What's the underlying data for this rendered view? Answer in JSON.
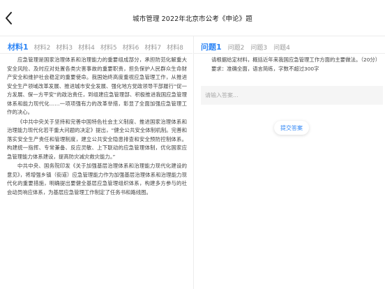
{
  "header": {
    "title": "城市管理 2022年北京市公考《申论》题",
    "back_icon": "chevron-left-icon"
  },
  "materials": {
    "tabs": [
      {
        "label": "材料1",
        "active": true
      },
      {
        "label": "材料2",
        "active": false
      },
      {
        "label": "材料3",
        "active": false
      },
      {
        "label": "材料4",
        "active": false
      },
      {
        "label": "材料5",
        "active": false
      },
      {
        "label": "材料6",
        "active": false
      },
      {
        "label": "材料7",
        "active": false
      },
      {
        "label": "材料8",
        "active": false
      }
    ],
    "paragraphs": [
      "应急管理是国家治理体系和治理能力的重要组成部分，承担防范化解重大安全风险、及时应对处置各类灾害事故的重要职责，担负保护人民群众生命财产安全和维护社会稳定的重要使命。我国始终高度重视应急管理工作，从推进安全生产领域改革发展、推进城市安全发展、强化地方党政领导干部履行“促一方发展、保一方平安”的政治责任，到组建应急管理部、积极推进我国应急管理体系和能力现代化……一项项强有力的改革举措，彰显了全面加强应急管理工作的决心。",
      "《中共中央关于坚持和完善中国特色社会主义制度、推进国家治理体系和治理能力现代化若干重大问题的决定》提出，“健全公共安全体制机制。完善和落实安全生产责任和管理制度，建立公共安全隐患排查和安全预防控制体系。构建统一指挥、专常兼备、反应灵敏、上下联动的应急管理体制，优化国家应急管理能力体系建设，提高防灾减灾救灾能力。”",
      "中共中央、国务院印发《关于加强基层治理体系和治理能力现代化建设的意见》，将增强乡镇（街道）应急管理能力作为加强基层治理体系和治理能力现代化的重要措施，明确提出要健全基层应急管理组织体系，构建多方参与的社会动员响应体系，为基层应急管理工作制定了任务书和路线图。"
    ]
  },
  "questions": {
    "tabs": [
      {
        "label": "问题1",
        "active": true
      },
      {
        "label": "问题2",
        "active": false
      },
      {
        "label": "问题3",
        "active": false
      },
      {
        "label": "问题4",
        "active": false
      }
    ],
    "prompt": "请根据给定材料，概括近年来我国应急管理工作方面的主要做法。（20分）",
    "requirement": "要求：准确全面，语言简练，字数不超过300字",
    "answer_placeholder": "请输入答案...",
    "submit_label": "提交答案"
  }
}
